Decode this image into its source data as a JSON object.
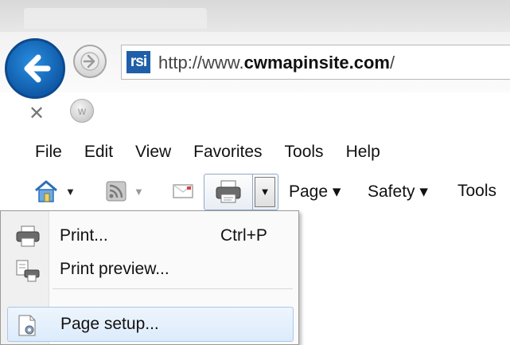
{
  "browser": {
    "url_prefix": "http://www.",
    "url_domain": "cwmapinsite.com",
    "url_suffix": "/",
    "site_icon_text": "rsi"
  },
  "menubar": {
    "items": [
      "File",
      "Edit",
      "View",
      "Favorites",
      "Tools",
      "Help"
    ]
  },
  "command_bar": {
    "page_label": "Page ▾",
    "safety_label": "Safety ▾",
    "tools_label": "Tools"
  },
  "print_menu": {
    "items": [
      {
        "label": "Print...",
        "shortcut": "Ctrl+P"
      },
      {
        "label": "Print preview...",
        "shortcut": ""
      },
      {
        "label": "Page setup...",
        "shortcut": ""
      }
    ]
  }
}
